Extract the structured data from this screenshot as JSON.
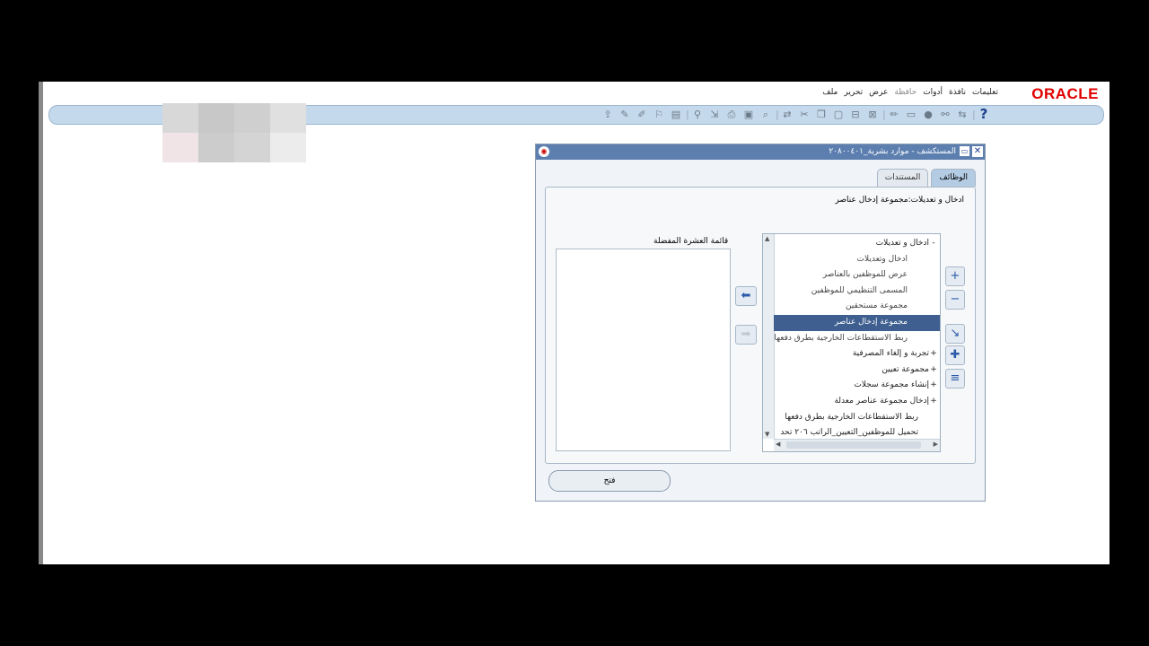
{
  "brand": "ORACLE",
  "menu": [
    {
      "label": "ملف",
      "dim": false
    },
    {
      "label": "تحرير",
      "dim": false
    },
    {
      "label": "عرض",
      "dim": false
    },
    {
      "label": "حافظة",
      "dim": true
    },
    {
      "label": "أدوات",
      "dim": false
    },
    {
      "label": "نافذة",
      "dim": false
    },
    {
      "label": "تعليمات",
      "dim": false
    }
  ],
  "toolbar_icons": [
    "new-record-icon",
    "translation-icon",
    "edit-field-icon",
    "attachment-icon",
    "folder-tools-icon",
    "separator",
    "zoom-icon",
    "export-icon",
    "print-icon",
    "save-icon",
    "find-icon",
    "separator",
    "navigate-icon",
    "cut-icon",
    "copy-icon",
    "paste-icon",
    "clear-record-icon",
    "delete-record-icon",
    "separator",
    "edit-icon",
    "folder-icon",
    "stop-icon",
    "attach-icon",
    "translate-icon",
    "separator",
    "help-icon"
  ],
  "window": {
    "title": "المستكشف - موارد بشرية_٢٠٨٠٠٤٠١",
    "tabs": [
      {
        "label": "الوظائف",
        "active": true
      },
      {
        "label": "المستندات",
        "active": false
      }
    ],
    "nav_path": "ادخال و تعديلات:مجموعة إدخال عناصر",
    "favorites_label": "قائمة العشرة المفضلة",
    "tree_items": [
      {
        "label": "ادخال و تعديلات",
        "expander": "-",
        "level": 0,
        "selected": false
      },
      {
        "label": "ادخال وتعديلات",
        "expander": "",
        "level": 1,
        "selected": false
      },
      {
        "label": "عرض للموظفين بالعناصر",
        "expander": "",
        "level": 1,
        "selected": false
      },
      {
        "label": "المسمى التنظيمي للموظفين",
        "expander": "",
        "level": 1,
        "selected": false
      },
      {
        "label": "مجموعة مستحقين",
        "expander": "",
        "level": 1,
        "selected": false
      },
      {
        "label": "مجموعة إدخال عناصر",
        "expander": "",
        "level": 1,
        "selected": true
      },
      {
        "label": "ربط الاستقطاعات الخارجية بطرق دفعها",
        "expander": "",
        "level": 1,
        "selected": false
      },
      {
        "label": "تجربة و إلغاء المصرفية",
        "expander": "+",
        "level": 0,
        "selected": false
      },
      {
        "label": "مجموعة تعيين",
        "expander": "+",
        "level": 0,
        "selected": false
      },
      {
        "label": "إنشاء مجموعة سجلات",
        "expander": "+",
        "level": 0,
        "selected": false
      },
      {
        "label": "إدخال مجموعة عناصر معدلة",
        "expander": "+",
        "level": 0,
        "selected": false
      },
      {
        "label": "ربط الاستقطاعات الخارجية بطرق دفعها",
        "expander": "",
        "level": 2,
        "selected": false
      },
      {
        "label": "تحميل للموظفين_التعيين_الراتب ٢٠٦ تحد",
        "expander": "",
        "level": 2,
        "selected": false
      }
    ],
    "open_button": "فتح"
  }
}
